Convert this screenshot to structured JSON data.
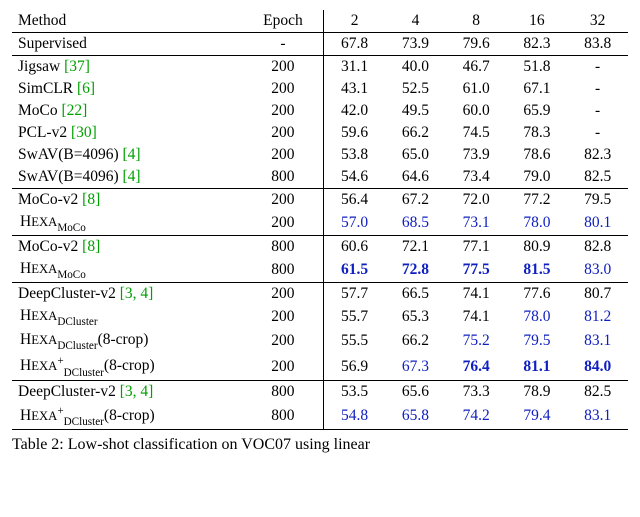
{
  "header": {
    "method": "Method",
    "epoch": "Epoch",
    "cols": [
      "2",
      "4",
      "8",
      "16",
      "32"
    ]
  },
  "rows": [
    {
      "method": {
        "text": "Supervised"
      },
      "epoch": "-",
      "vals": [
        {
          "t": "67.8"
        },
        {
          "t": "73.9"
        },
        {
          "t": "79.6"
        },
        {
          "t": "82.3"
        },
        {
          "t": "83.8"
        }
      ],
      "rule_after": true
    },
    {
      "method": {
        "text": "Jigsaw ",
        "cite": "[37]"
      },
      "epoch": "200",
      "vals": [
        {
          "t": "31.1"
        },
        {
          "t": "40.0"
        },
        {
          "t": "46.7"
        },
        {
          "t": "51.8"
        },
        {
          "t": "-"
        }
      ]
    },
    {
      "method": {
        "text": "SimCLR ",
        "cite": "[6]"
      },
      "epoch": "200",
      "vals": [
        {
          "t": "43.1"
        },
        {
          "t": "52.5"
        },
        {
          "t": "61.0"
        },
        {
          "t": "67.1"
        },
        {
          "t": "-"
        }
      ]
    },
    {
      "method": {
        "text": "MoCo ",
        "cite": "[22]"
      },
      "epoch": "200",
      "vals": [
        {
          "t": "42.0"
        },
        {
          "t": "49.5"
        },
        {
          "t": "60.0"
        },
        {
          "t": "65.9"
        },
        {
          "t": "-"
        }
      ]
    },
    {
      "method": {
        "text": "PCL-v2 ",
        "cite": "[30]"
      },
      "epoch": "200",
      "vals": [
        {
          "t": "59.6"
        },
        {
          "t": "66.2"
        },
        {
          "t": "74.5"
        },
        {
          "t": "78.3"
        },
        {
          "t": "-"
        }
      ]
    },
    {
      "method": {
        "text": "SwAV(B=4096) ",
        "cite": "[4]"
      },
      "epoch": "200",
      "vals": [
        {
          "t": "53.8"
        },
        {
          "t": "65.0"
        },
        {
          "t": "73.9"
        },
        {
          "t": "78.6"
        },
        {
          "t": "82.3"
        }
      ]
    },
    {
      "method": {
        "text": "SwAV(B=4096) ",
        "cite": "[4]"
      },
      "epoch": "800",
      "vals": [
        {
          "t": "54.6"
        },
        {
          "t": "64.6"
        },
        {
          "t": "73.4"
        },
        {
          "t": "79.0"
        },
        {
          "t": "82.5"
        }
      ],
      "rule_after": true
    },
    {
      "method": {
        "text": "MoCo-v2 ",
        "cite": "[8]"
      },
      "epoch": "200",
      "vals": [
        {
          "t": "56.4"
        },
        {
          "t": "67.2"
        },
        {
          "t": "72.0"
        },
        {
          "t": "77.2"
        },
        {
          "t": "79.5"
        }
      ]
    },
    {
      "method": {
        "hexa": true,
        "sub": "MoCo"
      },
      "indent": true,
      "epoch": "200",
      "vals": [
        {
          "t": "57.0",
          "c": "blue"
        },
        {
          "t": "68.5",
          "c": "blue"
        },
        {
          "t": "73.1",
          "c": "blue"
        },
        {
          "t": "78.0",
          "c": "blue"
        },
        {
          "t": "80.1",
          "c": "blue"
        }
      ],
      "rule_after": true
    },
    {
      "method": {
        "text": "MoCo-v2 ",
        "cite": "[8]"
      },
      "epoch": "800",
      "vals": [
        {
          "t": "60.6"
        },
        {
          "t": "72.1"
        },
        {
          "t": "77.1"
        },
        {
          "t": "80.9"
        },
        {
          "t": "82.8"
        }
      ]
    },
    {
      "method": {
        "hexa": true,
        "sub": "MoCo"
      },
      "indent": true,
      "epoch": "800",
      "vals": [
        {
          "t": "61.5",
          "c": "blue",
          "b": true
        },
        {
          "t": "72.8",
          "c": "blue",
          "b": true
        },
        {
          "t": "77.5",
          "c": "blue",
          "b": true
        },
        {
          "t": "81.5",
          "c": "blue",
          "b": true
        },
        {
          "t": "83.0",
          "c": "blue"
        }
      ],
      "rule_after": true
    },
    {
      "method": {
        "text": "DeepCluster-v2 ",
        "cite": "[3, 4]"
      },
      "epoch": "200",
      "vals": [
        {
          "t": "57.7"
        },
        {
          "t": "66.5"
        },
        {
          "t": "74.1"
        },
        {
          "t": "77.6"
        },
        {
          "t": "80.7"
        }
      ]
    },
    {
      "method": {
        "hexa": true,
        "sub": "DCluster"
      },
      "indent": true,
      "epoch": "200",
      "vals": [
        {
          "t": "55.7"
        },
        {
          "t": "65.3"
        },
        {
          "t": "74.1"
        },
        {
          "t": "78.0",
          "c": "blue"
        },
        {
          "t": "81.2",
          "c": "blue"
        }
      ]
    },
    {
      "method": {
        "hexa": true,
        "sub": "DCluster",
        "paren": "(8-crop)"
      },
      "indent": true,
      "epoch": "200",
      "vals": [
        {
          "t": "55.5"
        },
        {
          "t": "66.2"
        },
        {
          "t": "75.2",
          "c": "blue"
        },
        {
          "t": "79.5",
          "c": "blue"
        },
        {
          "t": "83.1",
          "c": "blue"
        }
      ]
    },
    {
      "method": {
        "hexa": true,
        "sub": "DCluster",
        "sup": "+",
        "paren": "(8-crop)"
      },
      "indent": true,
      "epoch": "200",
      "vals": [
        {
          "t": "56.9"
        },
        {
          "t": "67.3",
          "c": "blue"
        },
        {
          "t": "76.4",
          "c": "blue",
          "b": true
        },
        {
          "t": "81.1",
          "c": "blue",
          "b": true
        },
        {
          "t": "84.0",
          "c": "blue",
          "b": true
        }
      ],
      "rule_after": true
    },
    {
      "method": {
        "text": "DeepCluster-v2 ",
        "cite": "[3, 4]"
      },
      "epoch": "800",
      "vals": [
        {
          "t": "53.5"
        },
        {
          "t": "65.6"
        },
        {
          "t": "73.3"
        },
        {
          "t": "78.9"
        },
        {
          "t": "82.5"
        }
      ]
    },
    {
      "method": {
        "hexa": true,
        "sub": "DCluster",
        "sup": "+",
        "paren": "(8-crop)"
      },
      "indent": true,
      "epoch": "800",
      "vals": [
        {
          "t": "54.8",
          "c": "blue"
        },
        {
          "t": "65.8",
          "c": "blue"
        },
        {
          "t": "74.2",
          "c": "blue"
        },
        {
          "t": "79.4",
          "c": "blue"
        },
        {
          "t": "83.1",
          "c": "blue"
        }
      ],
      "rule_after": true
    }
  ],
  "caption": {
    "label": "Table 2:",
    "text": " Low-shot classification on VOC07 using linear"
  },
  "chart_data": {
    "type": "table",
    "columns": [
      "Method",
      "Epoch",
      "2",
      "4",
      "8",
      "16",
      "32"
    ],
    "rows": [
      [
        "Supervised",
        "-",
        67.8,
        73.9,
        79.6,
        82.3,
        83.8
      ],
      [
        "Jigsaw",
        200,
        31.1,
        40.0,
        46.7,
        51.8,
        null
      ],
      [
        "SimCLR",
        200,
        43.1,
        52.5,
        61.0,
        67.1,
        null
      ],
      [
        "MoCo",
        200,
        42.0,
        49.5,
        60.0,
        65.9,
        null
      ],
      [
        "PCL-v2",
        200,
        59.6,
        66.2,
        74.5,
        78.3,
        null
      ],
      [
        "SwAV(B=4096)",
        200,
        53.8,
        65.0,
        73.9,
        78.6,
        82.3
      ],
      [
        "SwAV(B=4096)",
        800,
        54.6,
        64.6,
        73.4,
        79.0,
        82.5
      ],
      [
        "MoCo-v2",
        200,
        56.4,
        67.2,
        72.0,
        77.2,
        79.5
      ],
      [
        "HEXA_MoCo",
        200,
        57.0,
        68.5,
        73.1,
        78.0,
        80.1
      ],
      [
        "MoCo-v2",
        800,
        60.6,
        72.1,
        77.1,
        80.9,
        82.8
      ],
      [
        "HEXA_MoCo",
        800,
        61.5,
        72.8,
        77.5,
        81.5,
        83.0
      ],
      [
        "DeepCluster-v2",
        200,
        57.7,
        66.5,
        74.1,
        77.6,
        80.7
      ],
      [
        "HEXA_DCluster",
        200,
        55.7,
        65.3,
        74.1,
        78.0,
        81.2
      ],
      [
        "HEXA_DCluster(8-crop)",
        200,
        55.5,
        66.2,
        75.2,
        79.5,
        83.1
      ],
      [
        "HEXA+_DCluster(8-crop)",
        200,
        56.9,
        67.3,
        76.4,
        81.1,
        84.0
      ],
      [
        "DeepCluster-v2",
        800,
        53.5,
        65.6,
        73.3,
        78.9,
        82.5
      ],
      [
        "HEXA+_DCluster(8-crop)",
        800,
        54.8,
        65.8,
        74.2,
        79.4,
        83.1
      ]
    ]
  }
}
